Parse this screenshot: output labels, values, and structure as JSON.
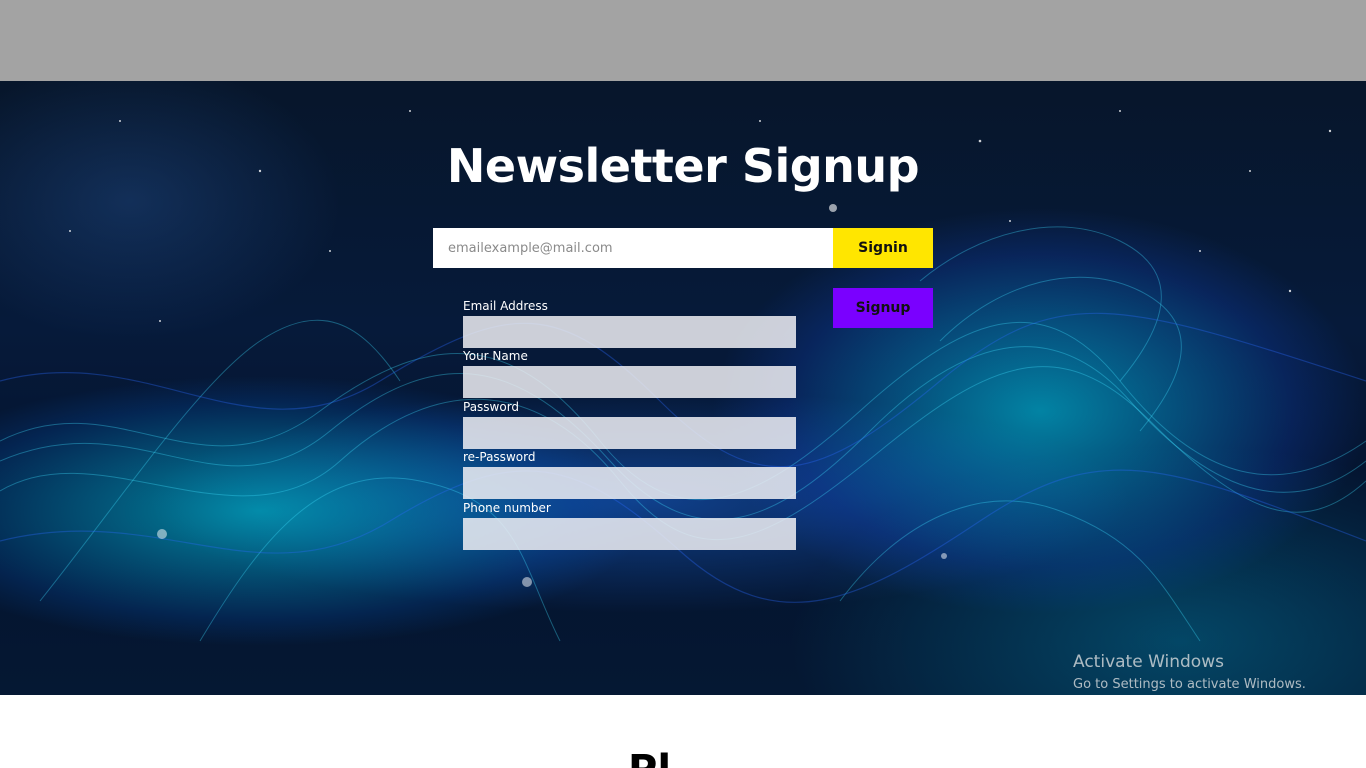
{
  "hero": {
    "title": "Newsletter Signup"
  },
  "quick_signin": {
    "email_placeholder": "emailexample@mail.com",
    "signin_label": "Signin",
    "signup_label": "Signup"
  },
  "signup_form": {
    "fields": [
      {
        "label": "Email Address"
      },
      {
        "label": "Your Name"
      },
      {
        "label": "Password"
      },
      {
        "label": "re-Password"
      },
      {
        "label": "Phone number"
      }
    ]
  },
  "os_watermark": {
    "title": "Activate Windows",
    "subtitle": "Go to Settings to activate Windows."
  },
  "next_section": {
    "heading_visible": "Pl"
  },
  "colors": {
    "topbar": "#a3a3a3",
    "signin_button": "#ffe600",
    "signup_button": "#7a00ff",
    "hero_text": "#ffffff"
  }
}
